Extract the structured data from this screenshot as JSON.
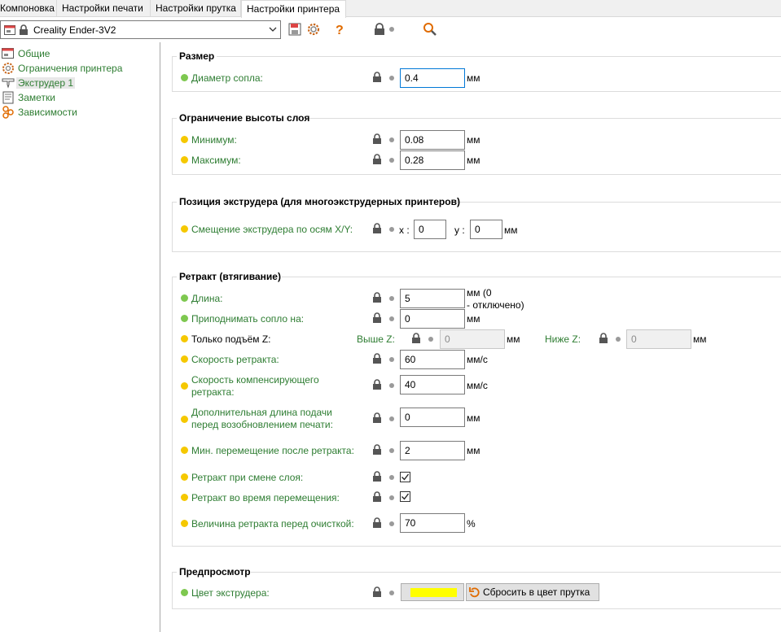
{
  "tabs": [
    {
      "label": "Компоновка",
      "active": false
    },
    {
      "label": "Настройки печати",
      "active": false
    },
    {
      "label": "Настройки прутка",
      "active": false
    },
    {
      "label": "Настройки принтера",
      "active": true
    }
  ],
  "toolbar": {
    "preset_name": "Creality Ender-3V2",
    "icons": [
      "printer-icon",
      "lock-icon",
      "chevron-down-icon",
      "save-icon",
      "gear-icon",
      "question-icon",
      "lock-icon",
      "search-icon"
    ]
  },
  "tree": [
    {
      "label": "Общие",
      "icon": "printer-icon"
    },
    {
      "label": "Ограничения принтера",
      "icon": "gear-icon"
    },
    {
      "label": "Экструдер 1",
      "icon": "extruder-icon",
      "selected": true
    },
    {
      "label": "Заметки",
      "icon": "notes-icon"
    },
    {
      "label": "Зависимости",
      "icon": "dependencies-icon"
    }
  ],
  "sections": {
    "size": {
      "title": "Размер",
      "nozzle_label": "Диаметр сопла:",
      "nozzle_value": "0.4",
      "nozzle_unit": "мм"
    },
    "layer_limits": {
      "title": "Ограничение высоты слоя",
      "min_label": "Минимум:",
      "min_value": "0.08",
      "min_unit": "мм",
      "max_label": "Максимум:",
      "max_value": "0.28",
      "max_unit": "мм"
    },
    "position": {
      "title": "Позиция экструдера (для многоэкструдерных принтеров)",
      "offset_label": "Смещение экструдера по осям X/Y:",
      "x_label": "x :",
      "x_value": "0",
      "y_label": "y :",
      "y_value": "0",
      "unit": "мм"
    },
    "retract": {
      "title": "Ретракт (втягивание)",
      "length_label": "Длина:",
      "length_value": "5",
      "length_unit_1": "мм (0",
      "length_unit_2": "- отключено)",
      "lift_label": "Приподнимать сопло на:",
      "lift_value": "0",
      "lift_unit": "мм",
      "only_lift_label": "Только подъём Z:",
      "above_label": "Выше Z:",
      "above_value": "0",
      "above_unit": "мм",
      "below_label": "Ниже Z:",
      "below_value": "0",
      "below_unit": "мм",
      "speed_label": "Скорость ретракта:",
      "speed_value": "60",
      "speed_unit": "мм/с",
      "deretract_label_1": "Скорость компенсирующего",
      "deretract_label_2": "ретракта:",
      "deretract_value": "40",
      "deretract_unit": "мм/с",
      "extra_label_1": "Дополнительная длина подачи",
      "extra_label_2": "перед возобновлением печати:",
      "extra_value": "0",
      "extra_unit": "мм",
      "min_travel_label": "Мин. перемещение после ретракта:",
      "min_travel_value": "2",
      "min_travel_unit": "мм",
      "layer_change_label": "Ретракт при смене слоя:",
      "layer_change_checked": true,
      "wipe_label": "Ретракт во время перемещения:",
      "wipe_checked": true,
      "before_wipe_label": "Величина ретракта перед очисткой:",
      "before_wipe_value": "70",
      "before_wipe_unit": "%"
    },
    "preview": {
      "title": "Предпросмотр",
      "color_label": "Цвет экструдера:",
      "color_value": "#ffff00",
      "reset_label": "Сбросить в цвет прутка"
    }
  },
  "colors": {
    "label_green": "#2e7d32",
    "dot_green": "#7ec850",
    "dot_yellow": "#f5c800",
    "accent_orange": "#e06b00",
    "focus_blue": "#0078d7"
  }
}
